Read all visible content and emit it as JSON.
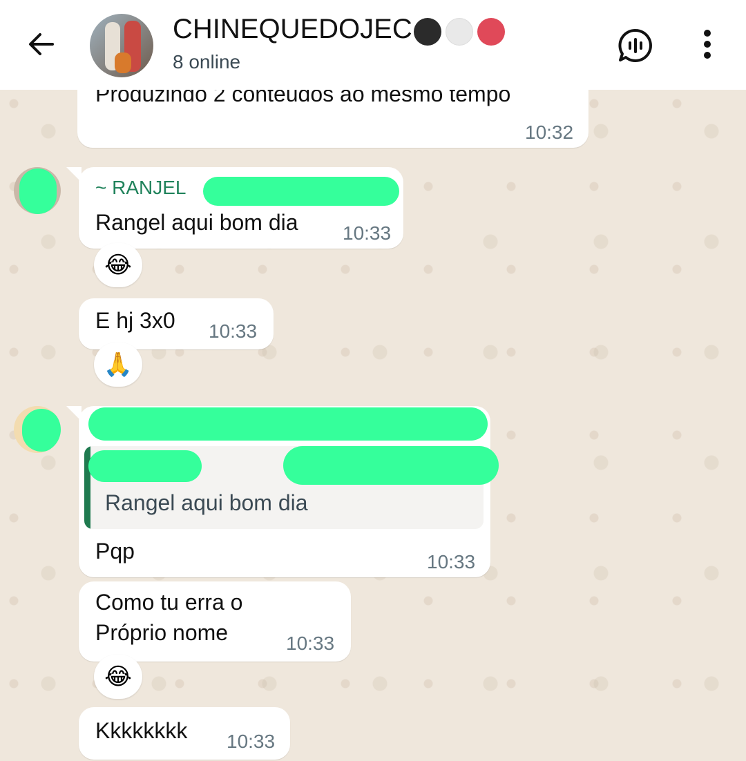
{
  "header": {
    "back_icon": "back-arrow-icon",
    "group_name": "CHINEQUEDOJEC",
    "group_name_emoji_dots": [
      "#2b2b2b",
      "#e9e9e9",
      "#e04959"
    ],
    "status": "8 online",
    "voice_chat_icon": "voice-chat-icon",
    "menu_icon": "more-vertical-icon"
  },
  "messages": [
    {
      "text": "Produzindo 2 conteudos ao mesmo tempo",
      "time": "10:32"
    },
    {
      "sender": "~ RANJEL",
      "text": "Rangel aqui bom dia",
      "time": "10:33",
      "reaction": "😂"
    },
    {
      "text": "E hj 3x0",
      "time": "10:33",
      "reaction": "🙏"
    },
    {
      "quoted_text": "Rangel aqui bom dia",
      "text": "Pqp",
      "time": "10:33"
    },
    {
      "text_line1": "Como tu erra o",
      "text_line2": "Próprio nome",
      "time": "10:33",
      "reaction": "😂"
    },
    {
      "text": "Kkkkkkkk",
      "time": "10:33"
    }
  ],
  "colors": {
    "accent_green": "#21835c",
    "redaction": "#35ff9b",
    "background": "#efe7dc"
  }
}
